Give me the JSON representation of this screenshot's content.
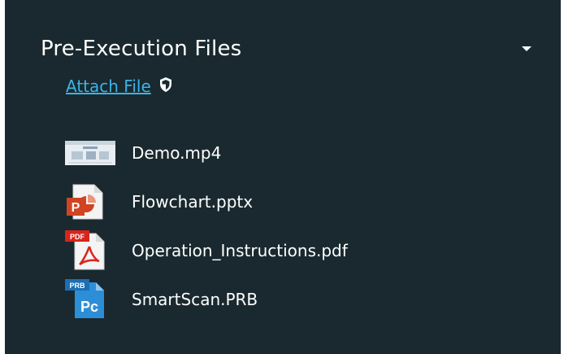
{
  "section": {
    "title": "Pre-Execution Files",
    "attach_label": "Attach File"
  },
  "files": [
    {
      "name": "Demo.mp4",
      "icon": "video-thumbnail-icon"
    },
    {
      "name": "Flowchart.pptx",
      "icon": "powerpoint-file-icon"
    },
    {
      "name": "Operation_Instructions.pdf",
      "icon": "pdf-file-icon"
    },
    {
      "name": "SmartScan.PRB",
      "icon": "prb-file-icon"
    }
  ],
  "colors": {
    "panel_bg": "#19292f",
    "link": "#3db3e6",
    "ppt": "#d04423",
    "pdf": "#d9241c",
    "prb": "#2d8ed8"
  }
}
